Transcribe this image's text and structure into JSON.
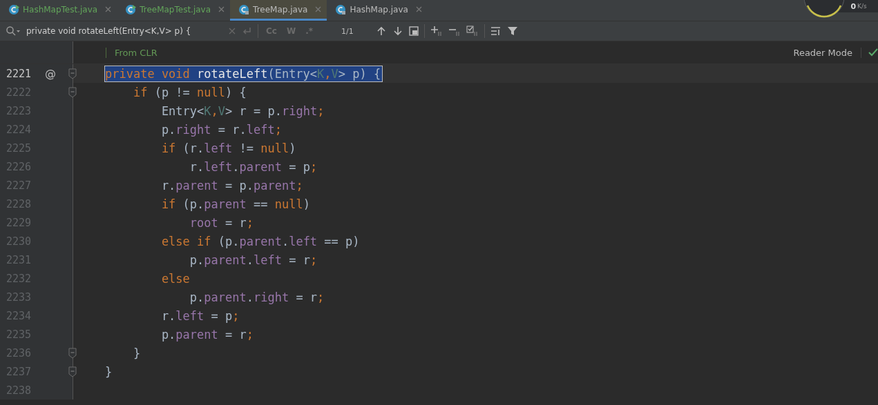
{
  "tabs": [
    {
      "label": "HashMapTest.java",
      "kind": "test",
      "color": "#62a45a",
      "selected": false
    },
    {
      "label": "TreeMapTest.java",
      "kind": "test",
      "color": "#62a45a",
      "selected": false
    },
    {
      "label": "TreeMap.java",
      "kind": "locked",
      "color": "#bbbbbb",
      "selected": true
    },
    {
      "label": "HashMap.java",
      "kind": "locked",
      "color": "#bbbbbb",
      "selected": false
    }
  ],
  "monitor": {
    "rate": "0",
    "unit": "K/s"
  },
  "search": {
    "value": "private void rotateLeft(Entry<K,V> p) {",
    "toggles": [
      "Cc",
      "W",
      ".*"
    ],
    "match_count": "1/1"
  },
  "editor": {
    "inlay_hint": "From CLR",
    "reader_mode": "Reader Mode",
    "lines": [
      {
        "number": "2221",
        "selected": true,
        "annotation": "@",
        "fold": true,
        "tokens": [
          {
            "kind": "kw",
            "text": "private void "
          },
          {
            "kind": "method",
            "text": "rotateLeft"
          },
          {
            "kind": "plain",
            "text": "(Entry<"
          },
          {
            "kind": "generic",
            "text": "K"
          },
          {
            "kind": "sep",
            "text": ","
          },
          {
            "kind": "generic",
            "text": "V"
          },
          {
            "kind": "plain",
            "text": "> p) {"
          }
        ]
      },
      {
        "number": "2222",
        "selected": false,
        "fold": true,
        "tokens": [
          {
            "kind": "kw",
            "text": "    if "
          },
          {
            "kind": "plain",
            "text": "(p != "
          },
          {
            "kind": "kw",
            "text": "null"
          },
          {
            "kind": "plain",
            "text": ") {"
          }
        ]
      },
      {
        "number": "2223",
        "selected": false,
        "fold": false,
        "tokens": [
          {
            "kind": "plain",
            "text": "        Entry<"
          },
          {
            "kind": "generic",
            "text": "K"
          },
          {
            "kind": "sep",
            "text": ","
          },
          {
            "kind": "generic",
            "text": "V"
          },
          {
            "kind": "plain",
            "text": "> r = p."
          },
          {
            "kind": "field",
            "text": "right"
          },
          {
            "kind": "sep",
            "text": ";"
          }
        ]
      },
      {
        "number": "2224",
        "selected": false,
        "fold": false,
        "tokens": [
          {
            "kind": "plain",
            "text": "        p."
          },
          {
            "kind": "field",
            "text": "right"
          },
          {
            "kind": "plain",
            "text": " = r."
          },
          {
            "kind": "field",
            "text": "left"
          },
          {
            "kind": "sep",
            "text": ";"
          }
        ]
      },
      {
        "number": "2225",
        "selected": false,
        "fold": false,
        "tokens": [
          {
            "kind": "kw",
            "text": "        if "
          },
          {
            "kind": "plain",
            "text": "(r."
          },
          {
            "kind": "field",
            "text": "left"
          },
          {
            "kind": "plain",
            "text": " != "
          },
          {
            "kind": "kw",
            "text": "null"
          },
          {
            "kind": "plain",
            "text": ")"
          }
        ]
      },
      {
        "number": "2226",
        "selected": false,
        "fold": false,
        "tokens": [
          {
            "kind": "plain",
            "text": "            r."
          },
          {
            "kind": "field",
            "text": "left"
          },
          {
            "kind": "plain",
            "text": "."
          },
          {
            "kind": "field",
            "text": "parent"
          },
          {
            "kind": "plain",
            "text": " = p"
          },
          {
            "kind": "sep",
            "text": ";"
          }
        ]
      },
      {
        "number": "2227",
        "selected": false,
        "fold": false,
        "tokens": [
          {
            "kind": "plain",
            "text": "        r."
          },
          {
            "kind": "field",
            "text": "parent"
          },
          {
            "kind": "plain",
            "text": " = p."
          },
          {
            "kind": "field",
            "text": "parent"
          },
          {
            "kind": "sep",
            "text": ";"
          }
        ]
      },
      {
        "number": "2228",
        "selected": false,
        "fold": false,
        "tokens": [
          {
            "kind": "kw",
            "text": "        if "
          },
          {
            "kind": "plain",
            "text": "(p."
          },
          {
            "kind": "field",
            "text": "parent"
          },
          {
            "kind": "plain",
            "text": " == "
          },
          {
            "kind": "kw",
            "text": "null"
          },
          {
            "kind": "plain",
            "text": ")"
          }
        ]
      },
      {
        "number": "2229",
        "selected": false,
        "fold": false,
        "tokens": [
          {
            "kind": "field",
            "text": "            root"
          },
          {
            "kind": "plain",
            "text": " = r"
          },
          {
            "kind": "sep",
            "text": ";"
          }
        ]
      },
      {
        "number": "2230",
        "selected": false,
        "fold": false,
        "tokens": [
          {
            "kind": "kw",
            "text": "        else if "
          },
          {
            "kind": "plain",
            "text": "(p."
          },
          {
            "kind": "field",
            "text": "parent"
          },
          {
            "kind": "plain",
            "text": "."
          },
          {
            "kind": "field",
            "text": "left"
          },
          {
            "kind": "plain",
            "text": " == p)"
          }
        ]
      },
      {
        "number": "2231",
        "selected": false,
        "fold": false,
        "tokens": [
          {
            "kind": "plain",
            "text": "            p."
          },
          {
            "kind": "field",
            "text": "parent"
          },
          {
            "kind": "plain",
            "text": "."
          },
          {
            "kind": "field",
            "text": "left"
          },
          {
            "kind": "plain",
            "text": " = r"
          },
          {
            "kind": "sep",
            "text": ";"
          }
        ]
      },
      {
        "number": "2232",
        "selected": false,
        "fold": false,
        "tokens": [
          {
            "kind": "kw",
            "text": "        else"
          }
        ]
      },
      {
        "number": "2233",
        "selected": false,
        "fold": false,
        "tokens": [
          {
            "kind": "plain",
            "text": "            p."
          },
          {
            "kind": "field",
            "text": "parent"
          },
          {
            "kind": "plain",
            "text": "."
          },
          {
            "kind": "field",
            "text": "right"
          },
          {
            "kind": "plain",
            "text": " = r"
          },
          {
            "kind": "sep",
            "text": ";"
          }
        ]
      },
      {
        "number": "2234",
        "selected": false,
        "fold": false,
        "tokens": [
          {
            "kind": "plain",
            "text": "        r."
          },
          {
            "kind": "field",
            "text": "left"
          },
          {
            "kind": "plain",
            "text": " = p"
          },
          {
            "kind": "sep",
            "text": ";"
          }
        ]
      },
      {
        "number": "2235",
        "selected": false,
        "fold": false,
        "tokens": [
          {
            "kind": "plain",
            "text": "        p."
          },
          {
            "kind": "field",
            "text": "parent"
          },
          {
            "kind": "plain",
            "text": " = r"
          },
          {
            "kind": "sep",
            "text": ";"
          }
        ]
      },
      {
        "number": "2236",
        "selected": false,
        "fold": true,
        "tokens": [
          {
            "kind": "plain",
            "text": "    }"
          }
        ]
      },
      {
        "number": "2237",
        "selected": false,
        "fold": true,
        "tokens": [
          {
            "kind": "plain",
            "text": "}"
          }
        ]
      },
      {
        "number": "2238",
        "selected": false,
        "fold": false
      }
    ]
  }
}
